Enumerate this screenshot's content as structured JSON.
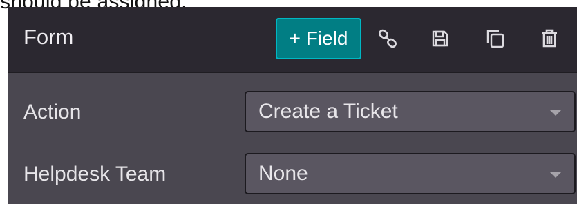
{
  "caption": {
    "text": "should be assigned."
  },
  "header": {
    "title": "Form",
    "add_field_label": "+ Field",
    "icons": [
      "link-icon",
      "save-icon",
      "duplicate-icon",
      "trash-icon"
    ]
  },
  "fields": [
    {
      "label": "Action",
      "value": "Create a Ticket"
    },
    {
      "label": "Helpdesk Team",
      "value": "None"
    }
  ],
  "colors": {
    "panel_bg": "#4a4750",
    "header_bg": "#2b2830",
    "accent": "#017e84",
    "accent_border": "#00b7c3",
    "select_bg": "#5a5661"
  }
}
